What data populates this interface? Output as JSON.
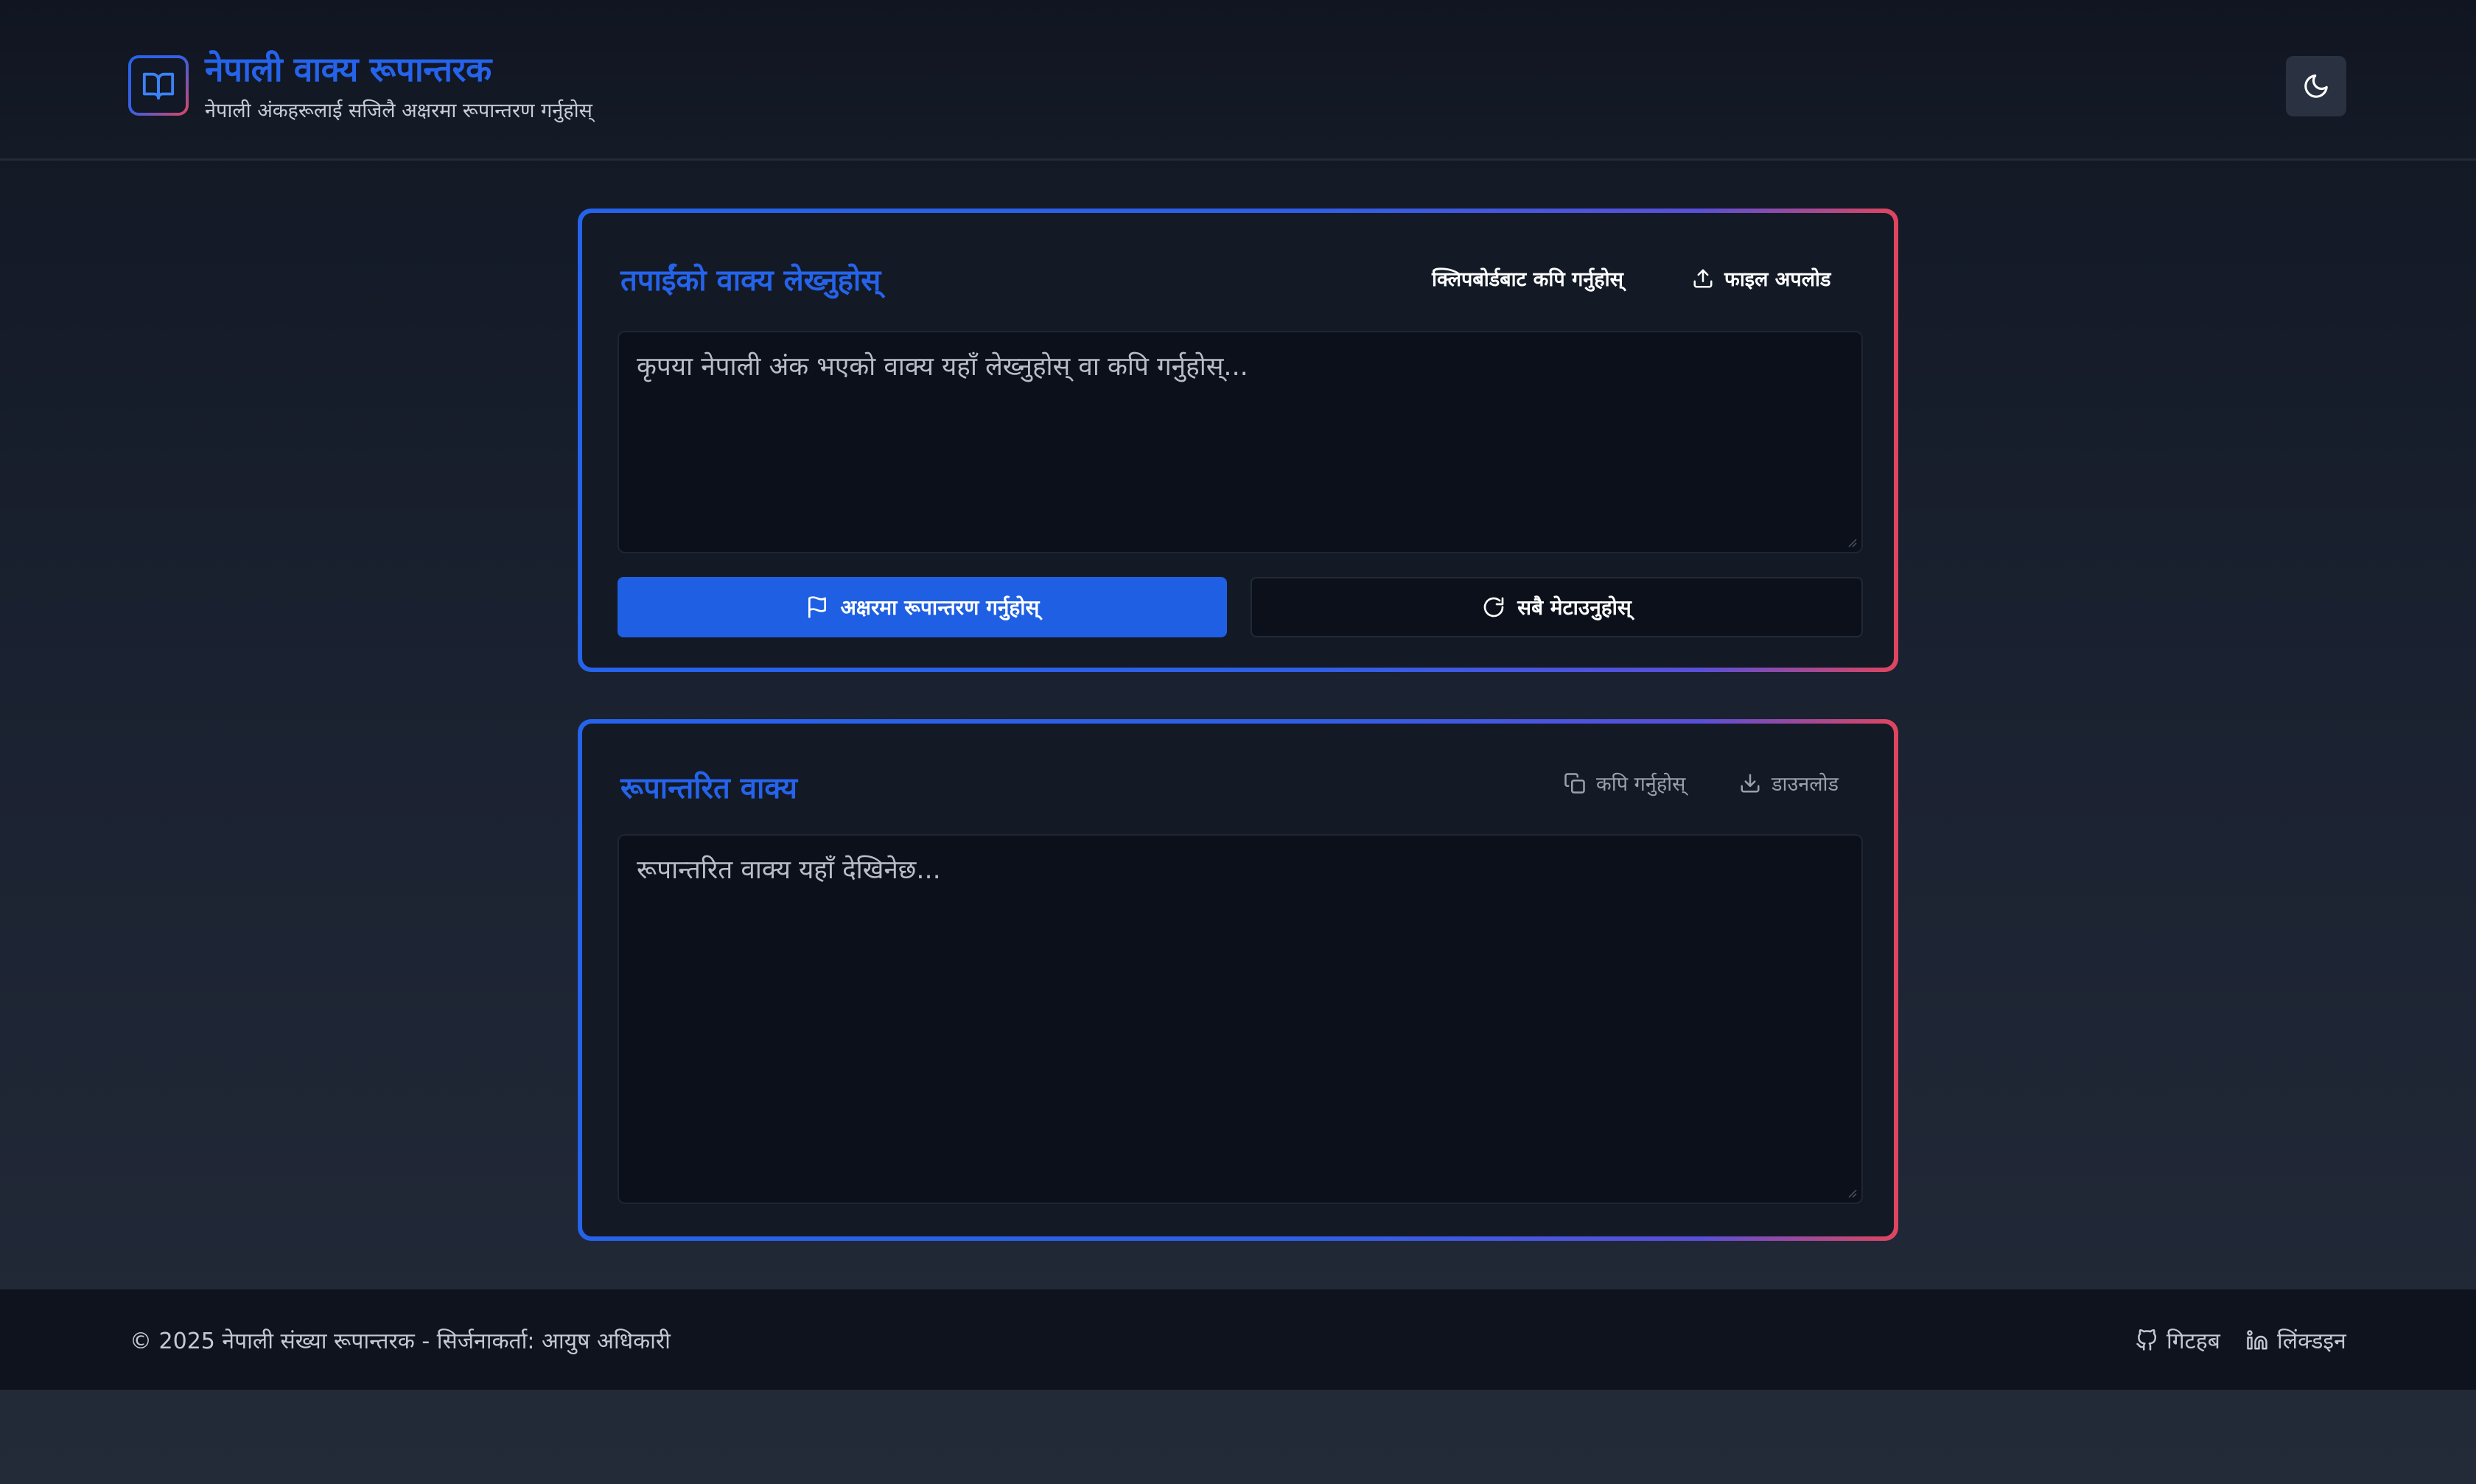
{
  "header": {
    "title": "नेपाली वाक्य रूपान्तरक",
    "subtitle": "नेपाली अंकहरूलाई सजिलै अक्षरमा रूपान्तरण गर्नुहोस्",
    "logo_icon": "book-icon",
    "theme_toggle_icon": "moon-icon"
  },
  "input_card": {
    "title": "तपाईंको वाक्य लेख्नुहोस्",
    "paste_label": "क्लिपबोर्डबाट कपि गर्नुहोस्",
    "upload_label": "फाइल अपलोड",
    "upload_icon": "upload-icon",
    "placeholder": "कृपया नेपाली अंक भएको वाक्य यहाँ लेख्नुहोस् वा कपि गर्नुहोस्...",
    "value": "",
    "convert_label": "अक्षरमा रूपान्तरण गर्नुहोस्",
    "convert_icon": "flag-icon",
    "reset_label": "सबै मेटाउनुहोस्",
    "reset_icon": "refresh-icon"
  },
  "output_card": {
    "title": "रूपान्तरित वाक्य",
    "copy_label": "कपि गर्नुहोस्",
    "copy_icon": "copy-icon",
    "download_label": "डाउनलोड",
    "download_icon": "download-icon",
    "placeholder": "रूपान्तरित वाक्य यहाँ देखिनेछ...",
    "value": ""
  },
  "footer": {
    "copyright": "© 2025 नेपाली संख्या रूपान्तरक - सिर्जनाकर्ता: आयुष अधिकारी",
    "github_label": "गिटहब",
    "github_icon": "github-icon",
    "linkedin_label": "लिंक्डइन",
    "linkedin_icon": "linkedin-icon"
  },
  "colors": {
    "accent": "#2563eb",
    "accent_secondary": "#e0455f",
    "background": "#161c28"
  }
}
